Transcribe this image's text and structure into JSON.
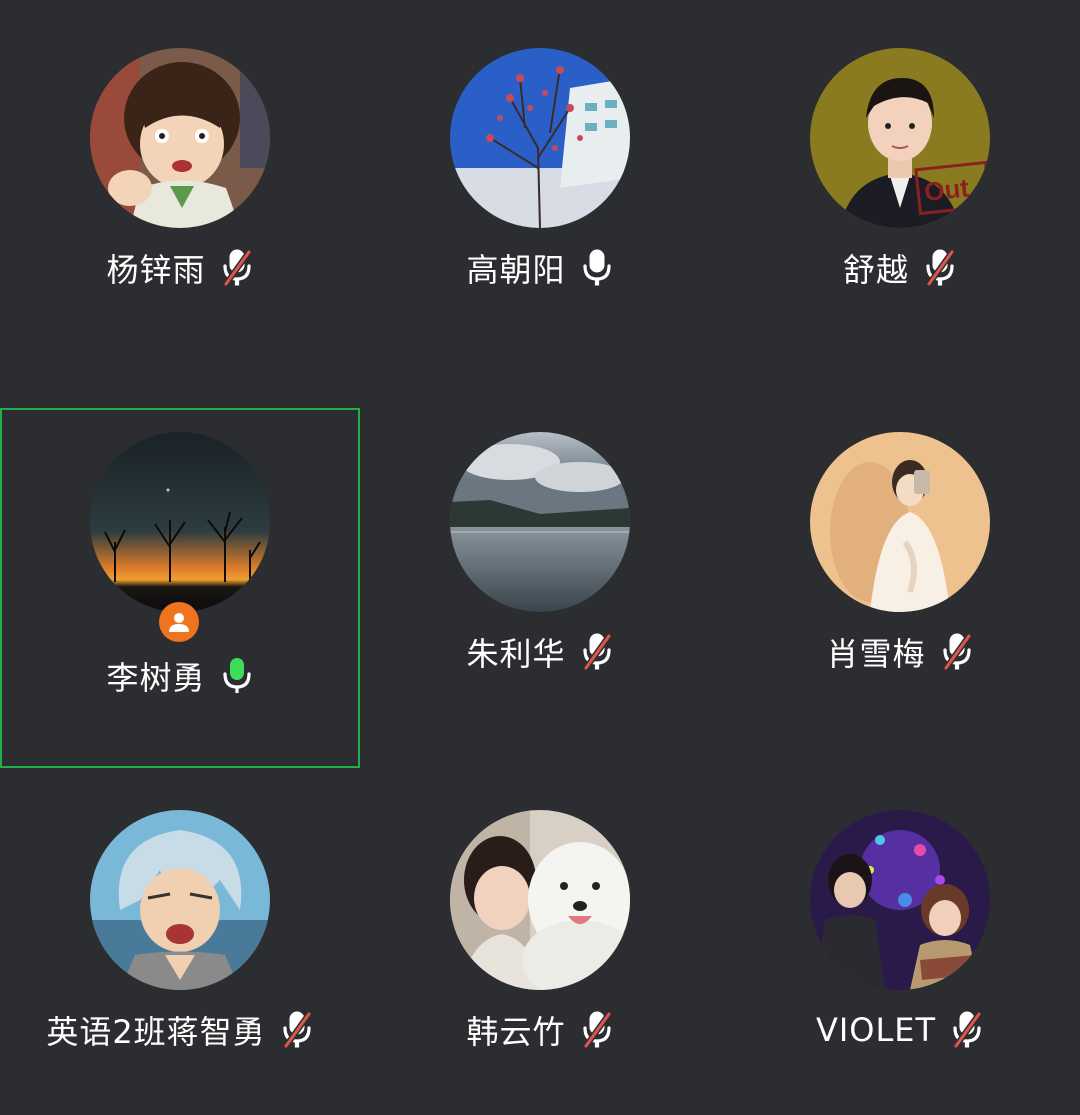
{
  "participants": [
    {
      "name": "杨锌雨",
      "mic": "muted"
    },
    {
      "name": "高朝阳",
      "mic": "on"
    },
    {
      "name": "舒越",
      "mic": "muted"
    },
    {
      "name": "李树勇",
      "mic": "speaking",
      "is_host": true,
      "active_speaker": true
    },
    {
      "name": "朱利华",
      "mic": "muted"
    },
    {
      "name": "肖雪梅",
      "mic": "muted"
    },
    {
      "name": "英语2班蒋智勇",
      "mic": "muted"
    },
    {
      "name": "韩云竹",
      "mic": "muted"
    },
    {
      "name": "VIOLET",
      "mic": "muted"
    }
  ],
  "avatar_overlays": {
    "shuyue_text": "Out"
  },
  "colors": {
    "background": "#2b2d30",
    "active_border": "#22b04b",
    "speaking_mic": "#3ddc5b",
    "muted_slash": "#e0544b",
    "host_badge": "#f0731f"
  }
}
